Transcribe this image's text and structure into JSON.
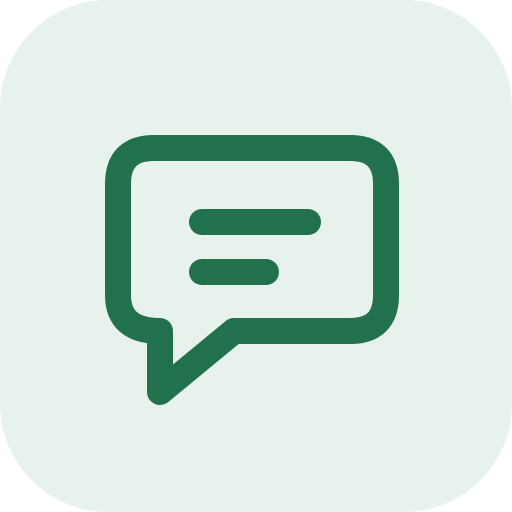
{
  "app_icon": {
    "icon_name": "chat-bubble-icon",
    "background_color": "#e7f2ec",
    "icon_color": "#20714c"
  }
}
